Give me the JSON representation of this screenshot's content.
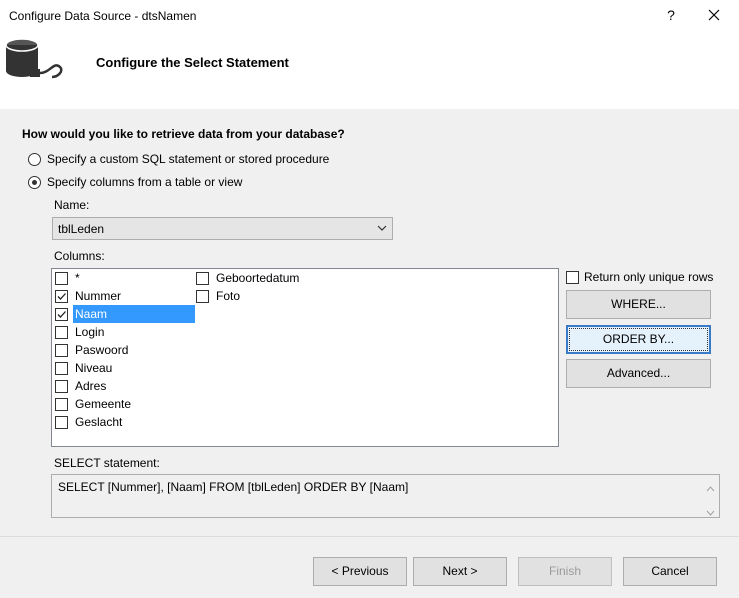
{
  "window": {
    "title": "Configure Data Source - dtsNamen",
    "help_label": "?"
  },
  "header": {
    "title": "Configure the Select Statement"
  },
  "question": "How would you like to retrieve data from your database?",
  "options": [
    {
      "label": "Specify a custom SQL statement or stored procedure",
      "checked": false
    },
    {
      "label": "Specify columns from a table or view",
      "checked": true
    }
  ],
  "name": {
    "label": "Name:",
    "value": "tblLeden"
  },
  "columns": {
    "label": "Columns:",
    "items": [
      {
        "label": "*",
        "checked": false,
        "selected": false
      },
      {
        "label": "Nummer",
        "checked": true,
        "selected": false
      },
      {
        "label": "Naam",
        "checked": true,
        "selected": true
      },
      {
        "label": "Login",
        "checked": false,
        "selected": false
      },
      {
        "label": "Paswoord",
        "checked": false,
        "selected": false
      },
      {
        "label": "Niveau",
        "checked": false,
        "selected": false
      },
      {
        "label": "Adres",
        "checked": false,
        "selected": false
      },
      {
        "label": "Gemeente",
        "checked": false,
        "selected": false
      },
      {
        "label": "Geslacht",
        "checked": false,
        "selected": false
      },
      {
        "label": "Geboortedatum",
        "checked": false,
        "selected": false
      },
      {
        "label": "Foto",
        "checked": false,
        "selected": false
      }
    ]
  },
  "unique_rows": {
    "label": "Return only unique rows",
    "checked": false
  },
  "side_buttons": {
    "where": "WHERE...",
    "order_by": "ORDER BY...",
    "advanced": "Advanced..."
  },
  "sql": {
    "label": "SELECT statement:",
    "text": "SELECT [Nummer], [Naam] FROM [tblLeden] ORDER BY [Naam]"
  },
  "footer": {
    "previous": "< Previous",
    "next": "Next >",
    "finish": "Finish",
    "cancel": "Cancel"
  },
  "colors": {
    "selection": "#3399ff",
    "background": "#f0f0f0",
    "focus_border": "#3a7bc8"
  }
}
